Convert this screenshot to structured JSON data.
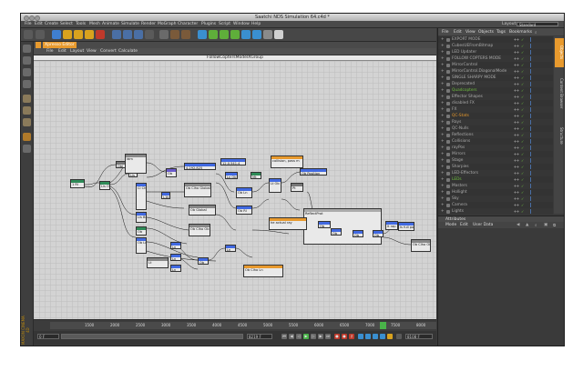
{
  "window": {
    "title": "Saatchi NDS Simulation 64.c4d *"
  },
  "menubar": {
    "items": [
      "File",
      "Edit",
      "Create",
      "Select",
      "Tools",
      "Mesh",
      "Animate",
      "Simulate",
      "Render",
      "MoGraph",
      "Character",
      "Plugins",
      "Script",
      "Window",
      "Help"
    ],
    "layout_label": "Layout:",
    "layout_value": "Standard"
  },
  "xpresso": {
    "tabs": [
      "Xpresso Editor"
    ],
    "menu": [
      "File",
      "Edit",
      "Layout",
      "View",
      "Convert",
      "Calculate"
    ],
    "canvas_title": "FollowCoptersModelXGroup",
    "nodes": [
      {
        "id": "n1",
        "label": "1 Rl"
      },
      {
        "id": "n2",
        "label": "Lis Ob"
      },
      {
        "id": "n3",
        "label": "Obj"
      },
      {
        "id": "n4",
        "label": "Lis"
      },
      {
        "id": "n5",
        "label": "Idm"
      },
      {
        "id": "n6",
        "label": "4.292.825"
      },
      {
        "id": "n7",
        "label": "Ob"
      },
      {
        "id": "n8",
        "label": "Cl Chl Ob"
      },
      {
        "id": "n9",
        "label": "Ob Clho Global"
      },
      {
        "id": "n10",
        "label": "Lis Bm"
      },
      {
        "id": "n11",
        "label": "L1b"
      },
      {
        "id": "n12",
        "label": "12.0.541.4"
      },
      {
        "id": "n13",
        "label": "Ln Ob"
      },
      {
        "id": "n14",
        "label": "Ob Ln"
      },
      {
        "id": "n15",
        "label": "Mt"
      },
      {
        "id": "n16",
        "label": "Lt Ob"
      },
      {
        "id": "n17",
        "label": "collision, pass m"
      },
      {
        "id": "n18",
        "label": "Ob Position"
      },
      {
        "id": "n19",
        "label": "Pt"
      },
      {
        "id": "n20",
        "label": "Ob Rl"
      },
      {
        "id": "n21",
        "label": "Ob Global"
      },
      {
        "id": "n22",
        "label": "Ob"
      },
      {
        "id": "n23",
        "label": "Ob Lis"
      },
      {
        "id": "n24",
        "label": "Ob Clho Ob"
      },
      {
        "id": "n25",
        "label": "ReflectProt"
      },
      {
        "id": "n26",
        "label": "he actual ray"
      },
      {
        "id": "n27",
        "label": "Ob"
      },
      {
        "id": "n28",
        "label": "Ob"
      },
      {
        "id": "n29",
        "label": "Ob"
      },
      {
        "id": "n30",
        "label": "Ob"
      },
      {
        "id": "n31",
        "label": "It rap lt"
      },
      {
        "id": "n32",
        "label": "Is full pos"
      },
      {
        "id": "n33",
        "label": "Ob Clho Ob"
      },
      {
        "id": "n34",
        "label": "Ln"
      },
      {
        "id": "n35",
        "label": "Ln"
      },
      {
        "id": "n36",
        "label": "Ln"
      },
      {
        "id": "n37",
        "label": "Ob"
      },
      {
        "id": "n38",
        "label": "Ob Clho Ln"
      },
      {
        "id": "n39",
        "label": "Ln"
      },
      {
        "id": "n40",
        "label": "Lt"
      }
    ]
  },
  "timeline": {
    "ticks": [
      "1500",
      "2000",
      "2500",
      "3000",
      "3500",
      "4000",
      "4500",
      "5000",
      "5500",
      "6000",
      "6500",
      "7000",
      "7500",
      "8000"
    ],
    "start_field": "0 F",
    "end_field": "8219 F",
    "current_field": "7500 F",
    "frame_field": "8108 F"
  },
  "objects": {
    "menu": [
      "File",
      "Edit",
      "View",
      "Objects",
      "Tags",
      "Bookmarks"
    ],
    "vertical_tabs": [
      "Objects",
      "Content Browser",
      "Structure"
    ],
    "items": [
      {
        "name": "EXPORT MODE",
        "color": "#aaaaaa"
      },
      {
        "name": "CubesUEFromBitmap",
        "color": "#aaaaaa"
      },
      {
        "name": "LED Updater",
        "color": "#aaaaaa"
      },
      {
        "name": "FOLLOW COPTERS MODE",
        "color": "#aaaaaa"
      },
      {
        "name": "MirrorControl",
        "color": "#aaaaaa"
      },
      {
        "name": "MirrorControl.DiagonalMode",
        "color": "#aaaaaa"
      },
      {
        "name": "SINGLE SHARPY MODE",
        "color": "#aaaaaa"
      },
      {
        "name": "Deprecated",
        "color": "#aaaaaa"
      },
      {
        "name": "Quadcopters",
        "color": "#6fbf3f"
      },
      {
        "name": "Effector Shapes",
        "color": "#aaaaaa"
      },
      {
        "name": "disabled FX",
        "color": "#aaaaaa"
      },
      {
        "name": "FX",
        "color": "#aaaaaa"
      },
      {
        "name": "QC-Stats",
        "color": "#e89a2e"
      },
      {
        "name": "Rays",
        "color": "#aaaaaa"
      },
      {
        "name": "QC-Nulls",
        "color": "#aaaaaa"
      },
      {
        "name": "Reflections",
        "color": "#aaaaaa"
      },
      {
        "name": "Collisions",
        "color": "#aaaaaa"
      },
      {
        "name": "rayPos",
        "color": "#aaaaaa"
      },
      {
        "name": "Mirrors",
        "color": "#aaaaaa"
      },
      {
        "name": "Stage",
        "color": "#aaaaaa"
      },
      {
        "name": "Sharpies",
        "color": "#aaaaaa"
      },
      {
        "name": "LED-Effectors",
        "color": "#aaaaaa"
      },
      {
        "name": "LEDs",
        "color": "#6fbf3f"
      },
      {
        "name": "Masters",
        "color": "#aaaaaa"
      },
      {
        "name": "Hollight",
        "color": "#aaaaaa"
      },
      {
        "name": "Sky",
        "color": "#aaaaaa"
      },
      {
        "name": "Camera",
        "color": "#aaaaaa"
      },
      {
        "name": "Lights",
        "color": "#aaaaaa"
      }
    ]
  },
  "attributes": {
    "title": "Attributes",
    "menu": [
      "Mode",
      "Edit",
      "User Data"
    ]
  },
  "colors": {
    "accent": "#e89a2e",
    "playhead": "#49b349",
    "record": "#c0392b"
  }
}
